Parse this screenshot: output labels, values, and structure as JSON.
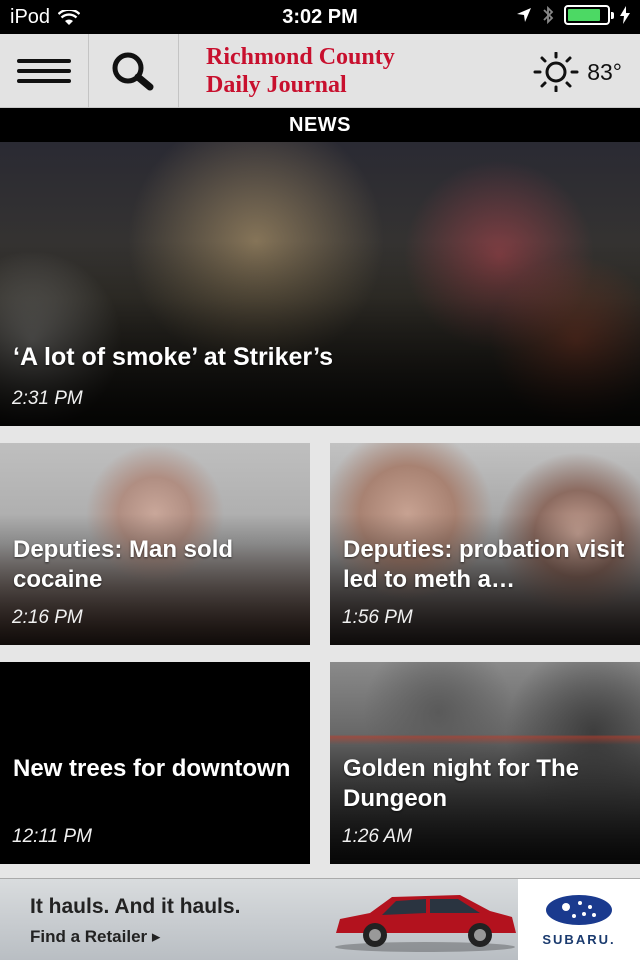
{
  "status_bar": {
    "carrier": "iPod",
    "time": "3:02 PM",
    "battery_level": 0.85
  },
  "header": {
    "menu_icon": "hamburger-icon",
    "search_icon": "search-icon",
    "logo_line1": "Richmond County",
    "logo_line2": "Daily Journal",
    "weather_icon": "sun-icon",
    "temperature": "83°",
    "brand_color": "#c8102e"
  },
  "section": {
    "title": "NEWS"
  },
  "articles": [
    {
      "title": "‘A lot of smoke’ at Striker’s",
      "time": "2:31 PM"
    },
    {
      "title": "Deputies: Man sold cocaine",
      "time": "2:16 PM"
    },
    {
      "title": "Deputies: probation visit led to meth a…",
      "time": "1:56 PM"
    },
    {
      "title": "New trees for downtown",
      "time": "12:11 PM"
    },
    {
      "title": "Golden night for The Dungeon",
      "time": "1:26 AM"
    }
  ],
  "ad": {
    "headline": "It hauls. And it hauls.",
    "cta": "Find a Retailer ▸",
    "brand": "SUBARU."
  }
}
